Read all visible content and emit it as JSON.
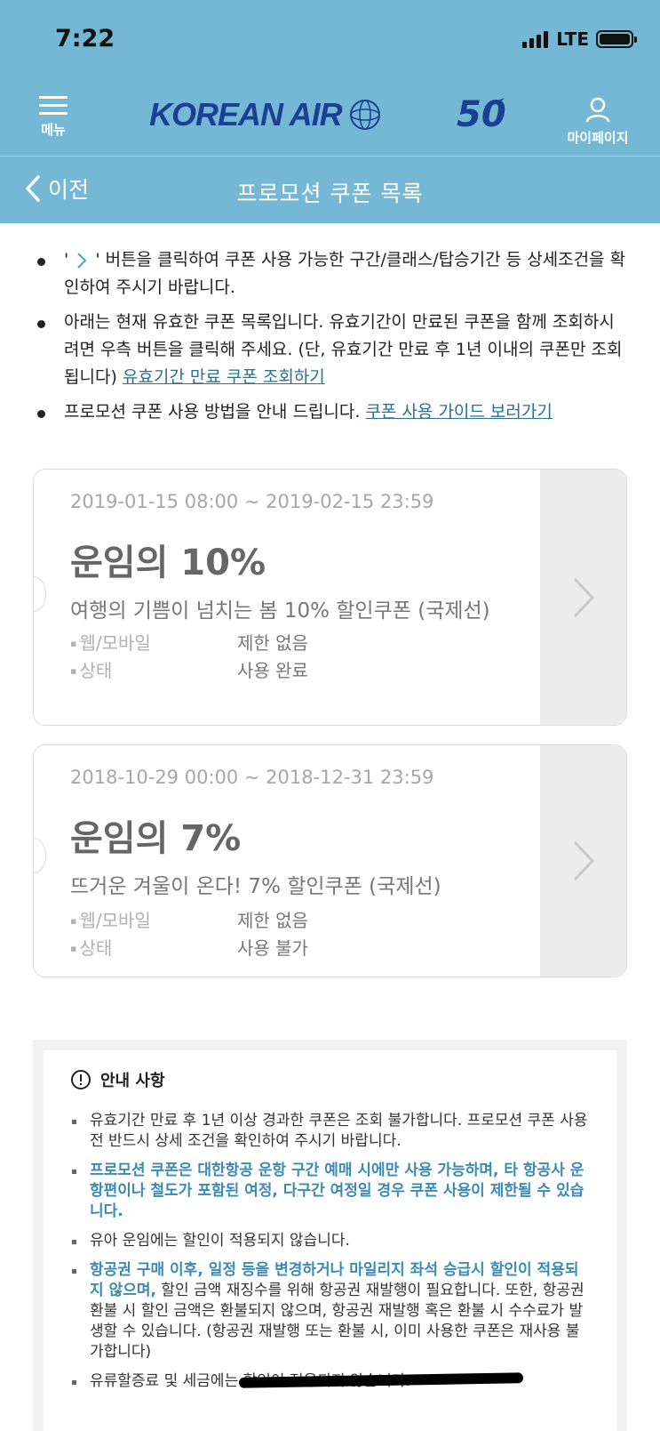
{
  "status": {
    "time": "7:22",
    "network": "LTE"
  },
  "header": {
    "menu_label": "메뉴",
    "logo_text": "KOREAN AIR",
    "anniversary": "50",
    "mypage_label": "마이페이지",
    "back_label": "이전",
    "title": "프로모션 쿠폰 목록",
    "bg_color": "#75b8d5",
    "logo_color": "#1b3f93"
  },
  "notes": [
    {
      "pre": "'",
      "post": "' 버튼을 클릭하여 쿠폰 사용 가능한 구간/클래스/탑승기간 등 상세조건을 확인하여 주시기 바랍니다."
    },
    {
      "text": "아래는 현재 유효한 쿠폰 목록입니다. 유효기간이 만료된 쿠폰을 함께 조회하시려면 우측 버튼을 클릭해 주세요. (단, 유효기간 만료 후 1년 이내의 쿠폰만 조회됩니다)",
      "link": "유효기간 만료 쿠폰 조회하기"
    },
    {
      "text": "프로모션 쿠폰 사용 방법을 안내 드립니다.",
      "link": "쿠폰 사용 가이드 보러가기"
    }
  ],
  "coupons": [
    {
      "period": "2019-01-15 08:00 ~ 2019-02-15 23:59",
      "title": "운임의 10%",
      "desc": "여행의 기쁨이 넘치는 봄 10% 할인쿠폰 (국제선)",
      "channel_label": "웹/모바일",
      "channel_value": "제한 없음",
      "status_label": "상태",
      "status_value": "사용 완료"
    },
    {
      "period": "2018-10-29 00:00 ~ 2018-12-31 23:59",
      "title": "운임의 7%",
      "desc": "뜨거운 겨울이 온다! 7% 할인쿠폰 (국제선)",
      "channel_label": "웹/모바일",
      "channel_value": "제한 없음",
      "status_label": "상태",
      "status_value": "사용 불가"
    }
  ],
  "notice": {
    "title": "안내 사항",
    "item1": "유효기간 만료 후 1년 이상 경과한 쿠폰은 조회 불가합니다. 프로모션 쿠폰 사용 전 반드시 상세 조건을 확인하여 주시기 바랍니다.",
    "item2": "프로모션 쿠폰은 대한항공 운항 구간 예매 시에만 사용 가능하며, 타 항공사 운항편이나 철도가 포함된 여정, 다구간 여정일 경우 쿠폰 사용이 제한될 수 있습니다.",
    "item3": "유아 운임에는 할인이 적용되지 않습니다.",
    "item4_bold": "항공권 구매 이후, 일정 등을 변경하거나 마일리지 좌석 승급시 할인이 적용되지 않으며,",
    "item4_rest": " 할인 금액 재징수를 위해 항공권 재발행이 필요합니다. 또한, 항공권 환불 시 할인 금액은 환불되지 않으며, 항공권 재발행 혹은 환불 시 수수료가 발생할 수 있습니다. (항공권 재발행 또는 환불 시, 이미 사용한 쿠폰은 재사용 불가합니다)",
    "item5": "유류할증료 및 세금에는 할인이 적용되지 않습니다."
  }
}
